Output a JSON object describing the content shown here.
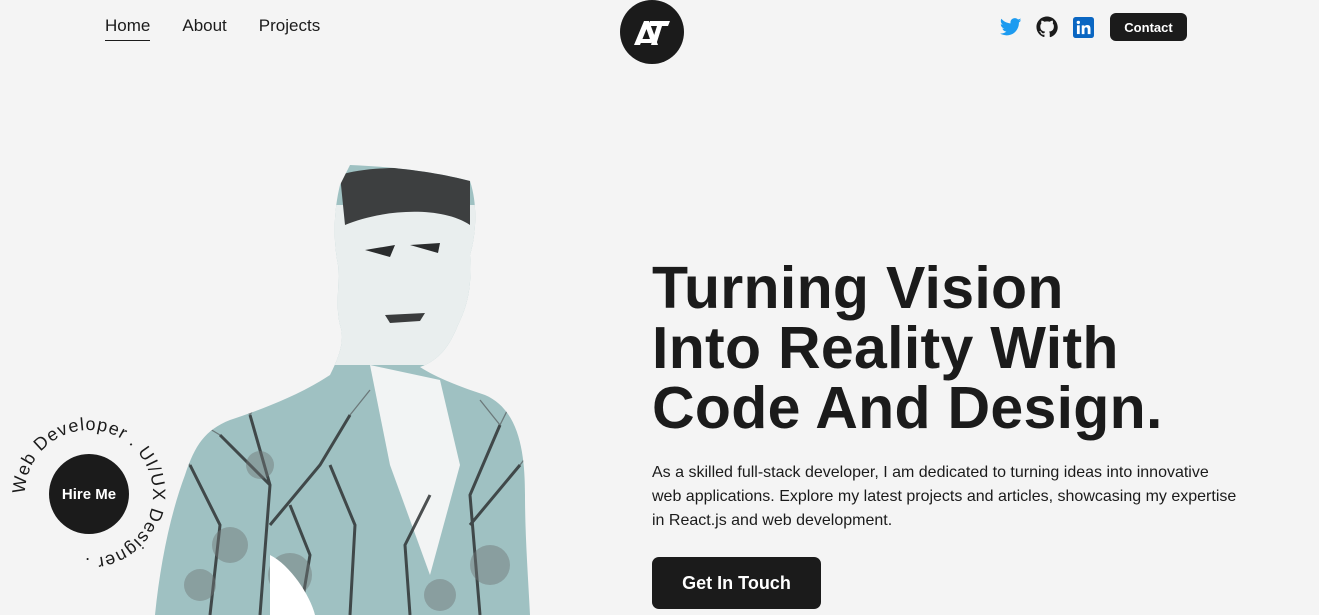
{
  "nav": {
    "links": [
      {
        "label": "Home",
        "active": true
      },
      {
        "label": "About",
        "active": false
      },
      {
        "label": "Projects",
        "active": false
      }
    ]
  },
  "header": {
    "logo_icon": "monogram-logo-icon",
    "socials": [
      {
        "icon": "twitter-icon",
        "color": "#1d9bf0"
      },
      {
        "icon": "github-icon",
        "color": "#1b1b1b"
      },
      {
        "icon": "linkedin-icon",
        "color": "#0a66c2"
      }
    ],
    "contact_label": "Contact"
  },
  "hero": {
    "title_lines": [
      "Turning Vision",
      "Into Reality With",
      "Code And Design."
    ],
    "description": "As a skilled full-stack developer, I am dedicated to turning ideas into innovative web applications. Explore my latest projects and articles, showcasing my expertise in React.js and web development.",
    "cta_label": "Get In Touch"
  },
  "badge": {
    "label": "Hire Me",
    "ring_text": "Web Developer . UI/UX Designer ."
  },
  "colors": {
    "background": "#f4f4f4",
    "dark": "#1b1b1b",
    "light": "#ffffff",
    "twitter": "#1d9bf0",
    "linkedin": "#0a66c2"
  }
}
